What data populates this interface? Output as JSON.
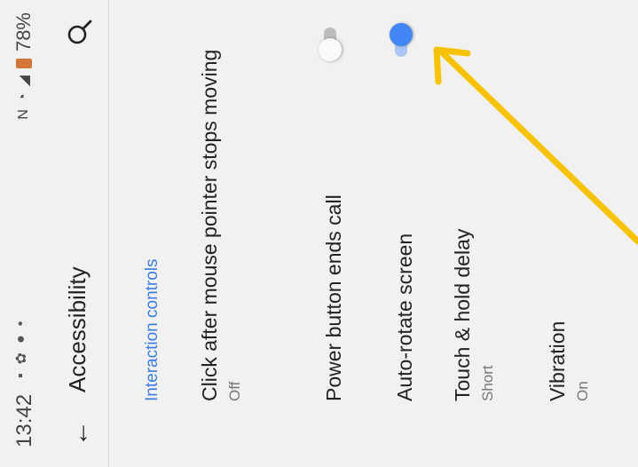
{
  "status_bar": {
    "time": "13:42",
    "battery": "78%"
  },
  "app_bar": {
    "title": "Accessibility"
  },
  "section": {
    "title": "Interaction controls"
  },
  "settings": [
    {
      "title": "Click after mouse pointer stops moving",
      "summary": "Off"
    },
    {
      "title": "Power button ends call",
      "toggle": false
    },
    {
      "title": "Auto-rotate screen",
      "toggle": true
    },
    {
      "title": "Touch & hold delay",
      "summary": "Short"
    },
    {
      "title": "Vibration",
      "summary": "On"
    }
  ],
  "colors": {
    "accent": "#3b7de0",
    "toggle_on_thumb": "#4285f4",
    "toggle_on_track": "#a9c6f5",
    "toggle_off_thumb": "#fafafa",
    "toggle_off_track": "#bdbdbd",
    "annotation_arrow": "#f7c200"
  },
  "icons": {
    "back": "arrow-left-icon",
    "search": "search-icon"
  }
}
